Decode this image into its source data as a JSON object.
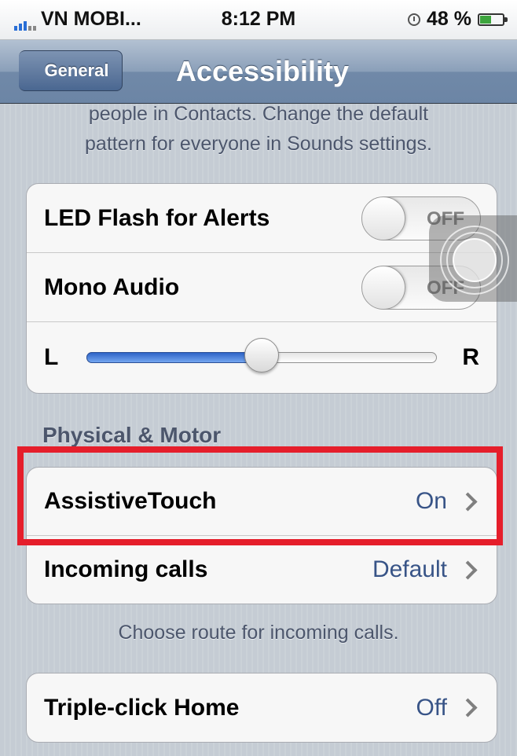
{
  "status_bar": {
    "carrier": "VN MOBI...",
    "time": "8:12 PM",
    "battery": "48 %",
    "battery_level": 0.48
  },
  "nav": {
    "back_label": "General",
    "title": "Accessibility"
  },
  "top_footer": {
    "line1": "people in Contacts. Change the default",
    "line2": "pattern for everyone in Sounds settings."
  },
  "hearing_group": {
    "led_flash": {
      "label": "LED Flash for Alerts",
      "switch": "OFF"
    },
    "mono_audio": {
      "label": "Mono Audio",
      "switch": "OFF"
    },
    "balance": {
      "left": "L",
      "right": "R",
      "value": 0.5
    }
  },
  "physical_motor": {
    "header": "Physical & Motor",
    "assistive_touch": {
      "label": "AssistiveTouch",
      "value": "On"
    },
    "incoming_calls": {
      "label": "Incoming calls",
      "value": "Default"
    },
    "footer": "Choose route for incoming calls."
  },
  "triple_click": {
    "label": "Triple-click Home",
    "value": "Off"
  },
  "colors": {
    "highlight": "#e51e2b",
    "value_blue": "#385487",
    "nav_blue": "#6c85a5"
  }
}
